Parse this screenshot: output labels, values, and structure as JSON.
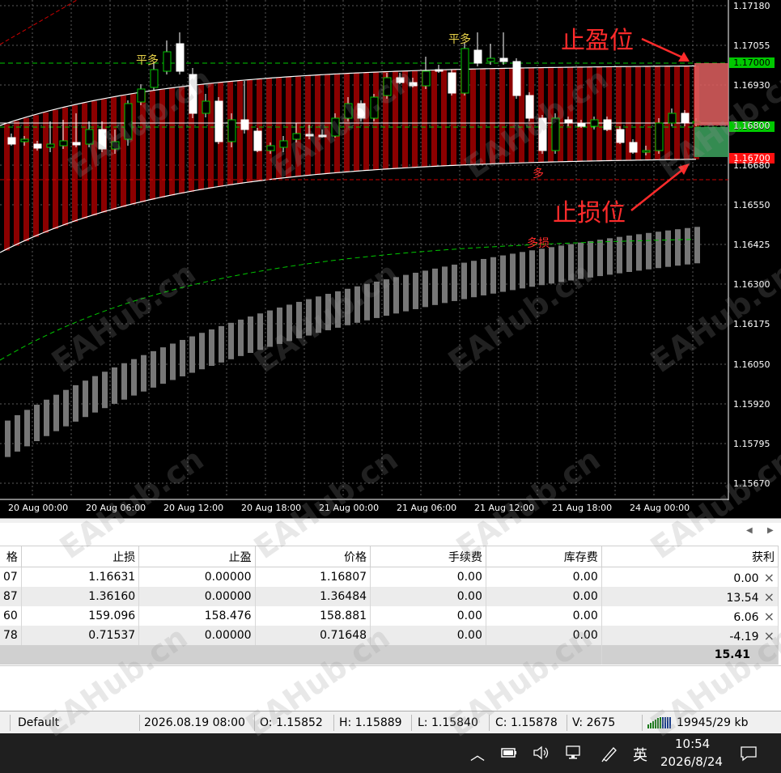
{
  "chart": {
    "background": "#000000",
    "band_color": "#8b0000",
    "price_axis": [
      "1.17180",
      "1.17055",
      "1.16930",
      "1.16800",
      "1.16680",
      "1.16550",
      "1.16425",
      "1.16300",
      "1.16175",
      "1.16050",
      "1.15920",
      "1.15795",
      "1.15670"
    ],
    "time_axis": [
      "20 Aug 00:00",
      "20 Aug 06:00",
      "20 Aug 12:00",
      "20 Aug 18:00",
      "21 Aug 00:00",
      "21 Aug 06:00",
      "21 Aug 12:00",
      "21 Aug 18:00",
      "24 Aug 00:00"
    ],
    "price_tags": {
      "take_profit": "1.17000",
      "current": "1.16800",
      "stop_loss": "1.16700"
    },
    "annotations": {
      "take_profit_label": "止盈位",
      "stop_loss_label": "止损位",
      "close_long_1": "平多",
      "close_long_2": "平多",
      "long_entry": "多",
      "long_sl": "多损"
    },
    "watermark": "EAHub.cn"
  },
  "orders": {
    "columns": [
      "格",
      "止损",
      "止盈",
      "价格",
      "手续费",
      "库存费",
      "获利"
    ],
    "rows": [
      [
        "07",
        "1.16631",
        "0.00000",
        "1.16807",
        "0.00",
        "0.00",
        "0.00"
      ],
      [
        "87",
        "1.36160",
        "0.00000",
        "1.36484",
        "0.00",
        "0.00",
        "13.54"
      ],
      [
        "60",
        "159.096",
        "158.476",
        "158.881",
        "0.00",
        "0.00",
        "6.06"
      ],
      [
        "78",
        "0.71537",
        "0.00000",
        "0.71648",
        "0.00",
        "0.00",
        "-4.19"
      ]
    ],
    "total": "15.41",
    "close_icon": "×"
  },
  "statusbar": {
    "profile": "Default",
    "datetime": "2026.08.19 08:00",
    "open": "O: 1.15852",
    "high": "H: 1.15889",
    "low": "L: 1.15840",
    "close": "C: 1.15878",
    "volume": "V: 2675",
    "traffic": "19945/29 kb"
  },
  "taskbar": {
    "ime": "英",
    "time": "10:54",
    "date": "2026/8/24"
  }
}
